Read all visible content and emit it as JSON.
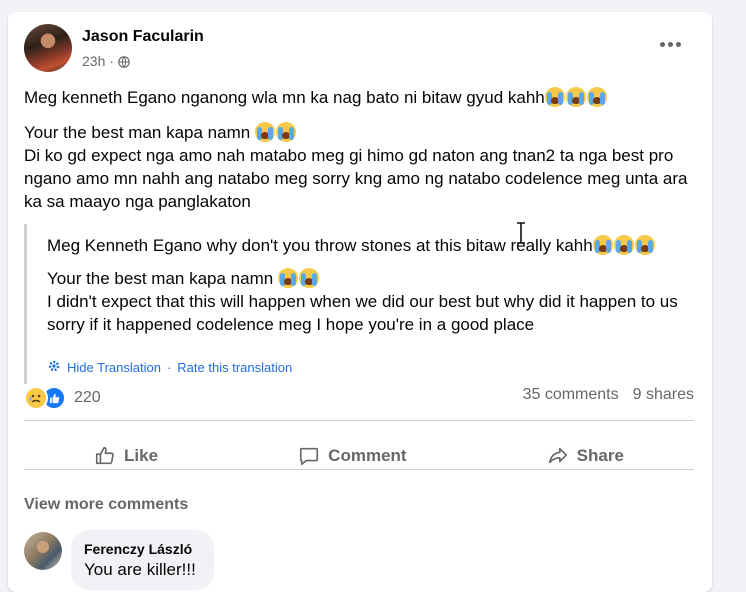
{
  "post": {
    "author": "Jason Facularin",
    "time": "23h",
    "dot": "·",
    "privacy_icon": "globe-icon",
    "original_line1": "Meg kenneth Egano nganong  wla mn ka nag bato ni bitaw gyud kahh",
    "original_line2": "Your the best man kapa namn",
    "original_line3": "Di ko gd expect nga amo nah matabo meg gi himo gd naton ang tnan2 ta nga best pro ngano amo mn nahh ang natabo meg sorry kng amo ng natabo codelence meg unta ara ka sa maayo nga panglakaton",
    "translated_line1": "Meg Kenneth Egano why don't you throw stones at this bitaw really kahh",
    "translated_line2": "Your the best man kapa namn",
    "translated_line3": "I didn't expect that this will happen when we did our best but why did it happen to us sorry if it happened codelence meg I hope you're in a good place",
    "hide_translation": "Hide Translation",
    "separator": "·",
    "rate_translation": "Rate this translation"
  },
  "stats": {
    "reaction_count": "220",
    "comments": "35 comments",
    "shares": "9 shares"
  },
  "actions": {
    "like": "Like",
    "comment": "Comment",
    "share": "Share"
  },
  "comments": {
    "view_more": "View more comments",
    "items": [
      {
        "author": "Ferenczy László",
        "text": "You are killer!!!"
      }
    ]
  },
  "colors": {
    "link_blue": "#216fdb",
    "like_blue": "#1877f2",
    "muted_text": "#65676b"
  }
}
